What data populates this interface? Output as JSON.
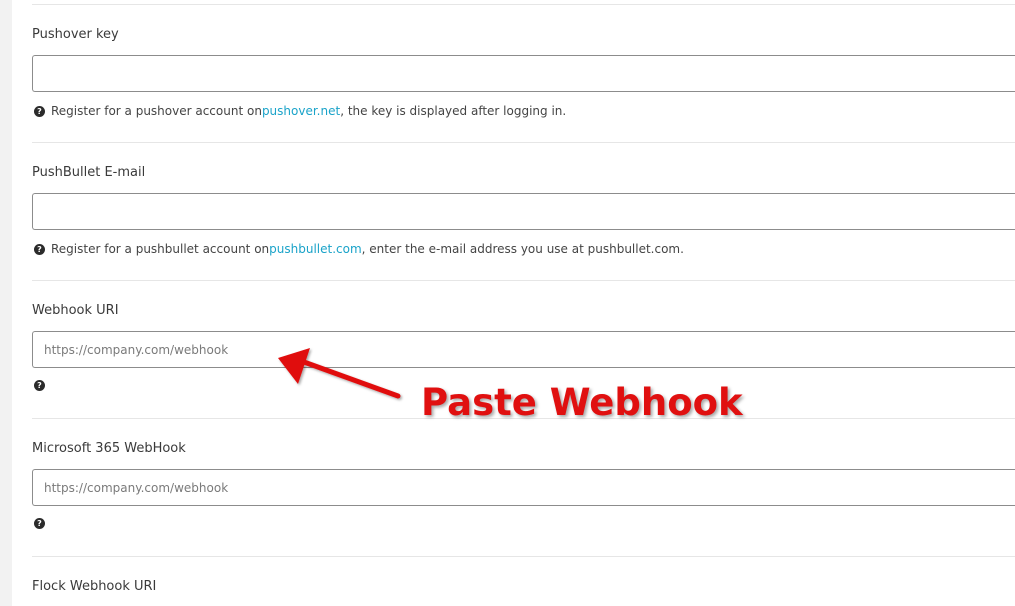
{
  "fields": {
    "pushover": {
      "label": "Pushover key",
      "value": "",
      "placeholder": "",
      "help_pre": "Register for a pushover account on ",
      "help_link": "pushover.net",
      "help_post": ", the key is displayed after logging in."
    },
    "pushbullet": {
      "label": "PushBullet E-mail",
      "value": "",
      "placeholder": "",
      "help_pre": "Register for a pushbullet account on ",
      "help_link": "pushbullet.com",
      "help_post": ", enter the e-mail address you use at pushbullet.com."
    },
    "webhook": {
      "label": "Webhook URI",
      "value": "",
      "placeholder": "https://company.com/webhook"
    },
    "ms365": {
      "label": "Microsoft 365 WebHook",
      "value": "",
      "placeholder": "https://company.com/webhook"
    },
    "flock": {
      "label": "Flock Webhook URI"
    }
  },
  "help_icon": "question-circle-icon",
  "annotation": {
    "text": "Paste Webhook",
    "color": "#e01010"
  },
  "colors": {
    "link": "#1aa3c9",
    "annotation_red": "#e01010"
  }
}
